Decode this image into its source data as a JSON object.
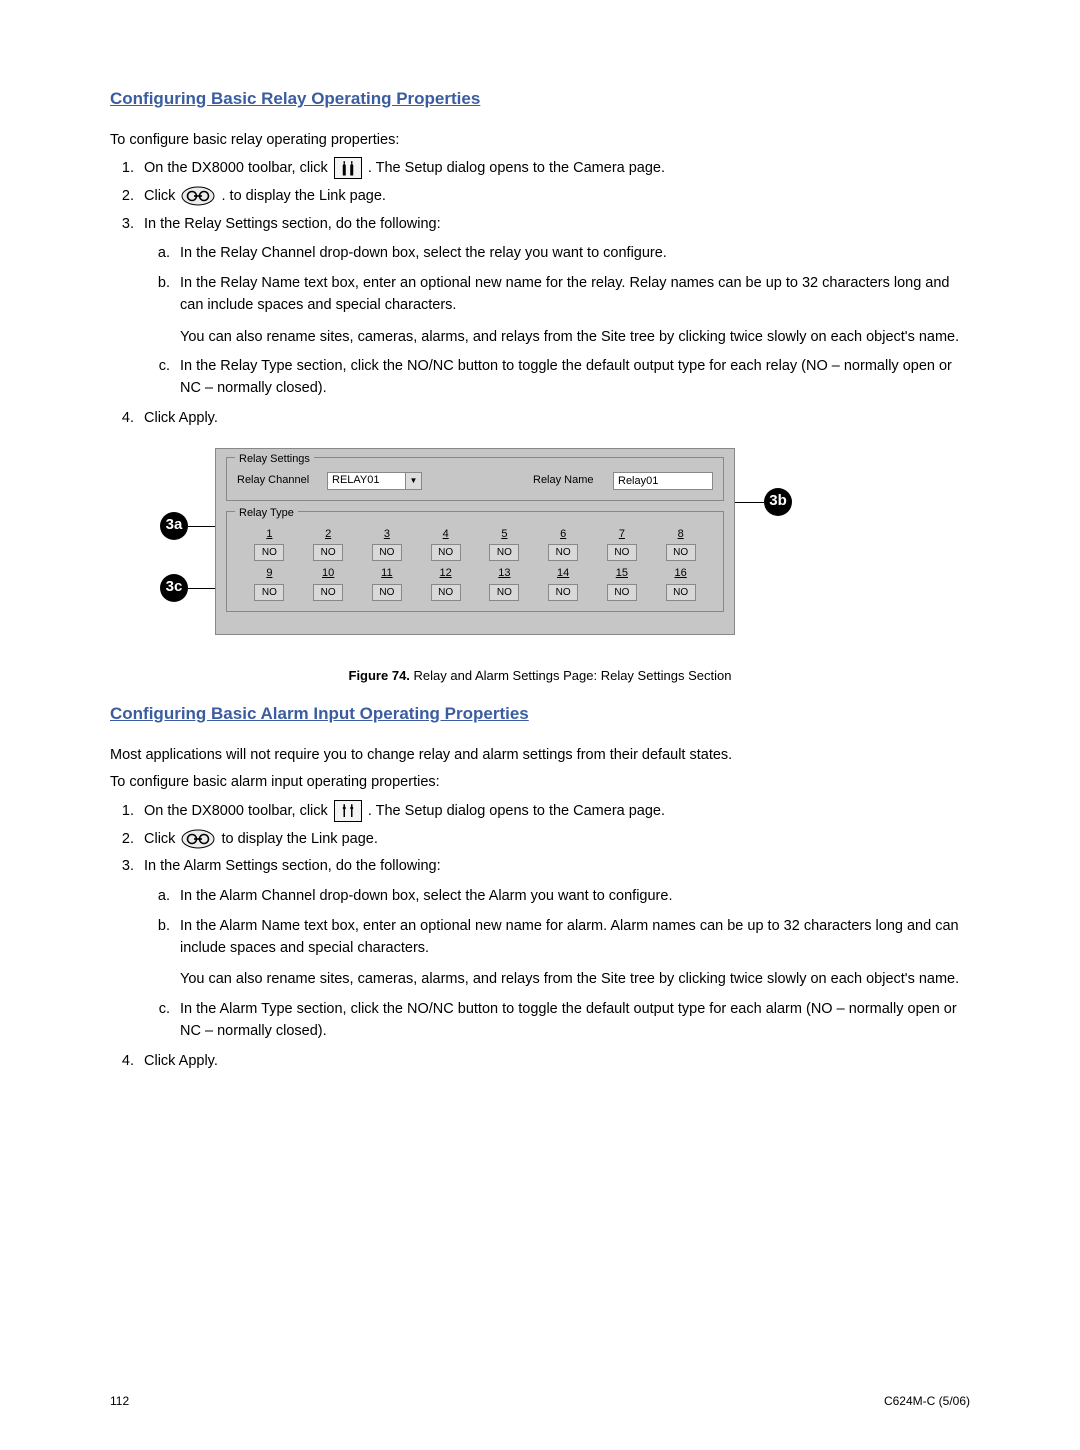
{
  "sections": {
    "s1": {
      "heading": "Configuring Basic Relay Operating Properties",
      "intro": "To configure basic relay operating properties:",
      "step1a": "On the DX8000 toolbar, click ",
      "step1b": ". The Setup dialog opens to the Camera page.",
      "step2a": "Click ",
      "step2b": ". to display the Link page.",
      "step3": "In the Relay Settings section, do the following:",
      "step3a": "In the Relay Channel drop-down box, select the relay you want to configure.",
      "step3b": "In the Relay Name text box, enter an optional new name for the relay. Relay names can be up to 32 characters long and can include spaces and special characters.",
      "step3b_note": "You can also rename sites, cameras, alarms, and relays from the Site tree by clicking twice slowly on each object's name.",
      "step3c": "In the Relay Type section, click the NO/NC button to toggle the default output type for each relay (NO – normally open or NC – normally closed).",
      "step4": "Click Apply."
    },
    "s2": {
      "heading": "Configuring Basic Alarm Input Operating Properties",
      "intro1": "Most applications will not require you to change relay and alarm settings from their default states.",
      "intro2": "To configure basic alarm input operating properties:",
      "step1a": "On the DX8000 toolbar, click ",
      "step1b": ". The Setup dialog opens to the Camera page.",
      "step2a": "Click ",
      "step2b": " to display the Link page.",
      "step3": "In the Alarm Settings section, do the following:",
      "step3a": "In the Alarm Channel drop-down box, select the Alarm you want to configure.",
      "step3b": "In the Alarm Name text box, enter an optional new name for alarm. Alarm names can be up to 32 characters long and can include spaces and special characters.",
      "step3b_note": "You can also rename sites, cameras, alarms, and relays from the Site tree by clicking twice slowly on each object's name.",
      "step3c": "In the Alarm Type section, click the NO/NC button to toggle the default output type for each alarm (NO – normally open or NC – normally closed).",
      "step4": "Click Apply."
    }
  },
  "figure": {
    "caption_bold": "Figure 74.",
    "caption_rest": " Relay and Alarm Settings Page: Relay Settings Section",
    "callouts": {
      "a": "3a",
      "b": "3b",
      "c": "3c"
    },
    "panel": {
      "legend_settings": "Relay Settings",
      "legend_type": "Relay Type",
      "relay_channel_label": "Relay Channel",
      "relay_channel_value": "RELAY01",
      "relay_name_label": "Relay Name",
      "relay_name_value": "Relay01",
      "relays": [
        {
          "n": "1",
          "v": "NO"
        },
        {
          "n": "2",
          "v": "NO"
        },
        {
          "n": "3",
          "v": "NO"
        },
        {
          "n": "4",
          "v": "NO"
        },
        {
          "n": "5",
          "v": "NO"
        },
        {
          "n": "6",
          "v": "NO"
        },
        {
          "n": "7",
          "v": "NO"
        },
        {
          "n": "8",
          "v": "NO"
        },
        {
          "n": "9",
          "v": "NO"
        },
        {
          "n": "10",
          "v": "NO"
        },
        {
          "n": "11",
          "v": "NO"
        },
        {
          "n": "12",
          "v": "NO"
        },
        {
          "n": "13",
          "v": "NO"
        },
        {
          "n": "14",
          "v": "NO"
        },
        {
          "n": "15",
          "v": "NO"
        },
        {
          "n": "16",
          "v": "NO"
        }
      ]
    }
  },
  "footer": {
    "page": "112",
    "docref": "C624M-C (5/06)"
  },
  "icons": {
    "setup_label": "setup",
    "link_label": "link"
  }
}
